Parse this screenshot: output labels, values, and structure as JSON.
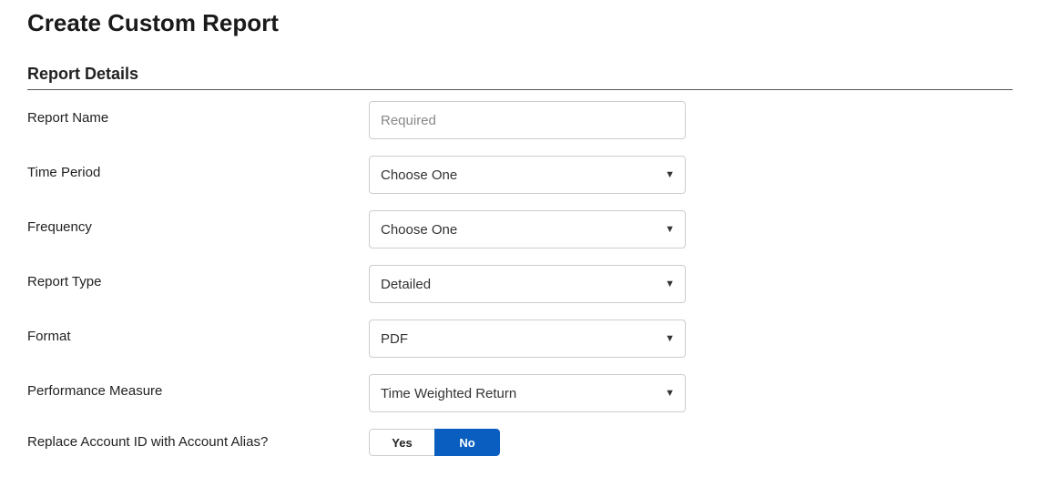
{
  "page_title": "Create Custom Report",
  "section_title": "Report Details",
  "fields": {
    "report_name": {
      "label": "Report Name",
      "placeholder": "Required",
      "value": ""
    },
    "time_period": {
      "label": "Time Period",
      "selected": "Choose One"
    },
    "frequency": {
      "label": "Frequency",
      "selected": "Choose One"
    },
    "report_type": {
      "label": "Report Type",
      "selected": "Detailed"
    },
    "format": {
      "label": "Format",
      "selected": "PDF"
    },
    "performance_measure": {
      "label": "Performance Measure",
      "selected": "Time Weighted Return"
    },
    "replace_alias": {
      "label": "Replace Account ID with Account Alias?",
      "yes": "Yes",
      "no": "No",
      "active": "no"
    }
  }
}
